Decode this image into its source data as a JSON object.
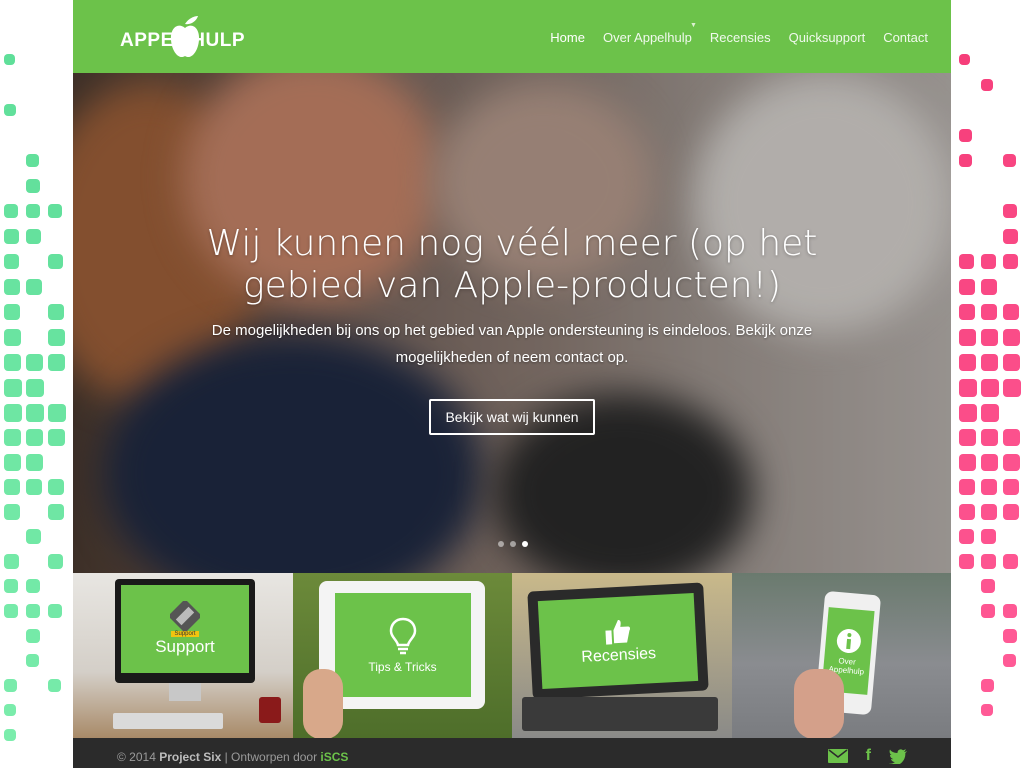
{
  "brand": {
    "logo_text": "APPEL HULP",
    "accent": "#6cc24a"
  },
  "nav": {
    "items": [
      {
        "label": "Home",
        "active": true
      },
      {
        "label": "Over Appelhulp",
        "has_dropdown": true
      },
      {
        "label": "Recensies"
      },
      {
        "label": "Quicksupport"
      },
      {
        "label": "Contact"
      }
    ]
  },
  "hero": {
    "title": "Wij kunnen nog véél meer (op het gebied van Apple-producten!)",
    "subtitle": "De mogelijkheden bij ons op het gebied van Apple ondersteuning is eindeloos. Bekijk onze mogelijkheden of neem contact op.",
    "button_label": "Bekijk wat wij kunnen",
    "slides": 3,
    "active_slide": 3
  },
  "tiles": [
    {
      "label": "Support",
      "icon": "tools-icon",
      "badge": "Support"
    },
    {
      "label": "Tips & Tricks",
      "icon": "lightbulb-icon"
    },
    {
      "label": "Recensies",
      "icon": "thumbs-up-icon"
    },
    {
      "label": "Over Appelhulp",
      "icon": "info-icon"
    }
  ],
  "footer": {
    "copyright": "© 2014 ",
    "project": "Project Six",
    "separator": " | Ontworpen door ",
    "designer": "iSCS",
    "social": [
      "email-icon",
      "facebook-icon",
      "twitter-icon"
    ]
  }
}
